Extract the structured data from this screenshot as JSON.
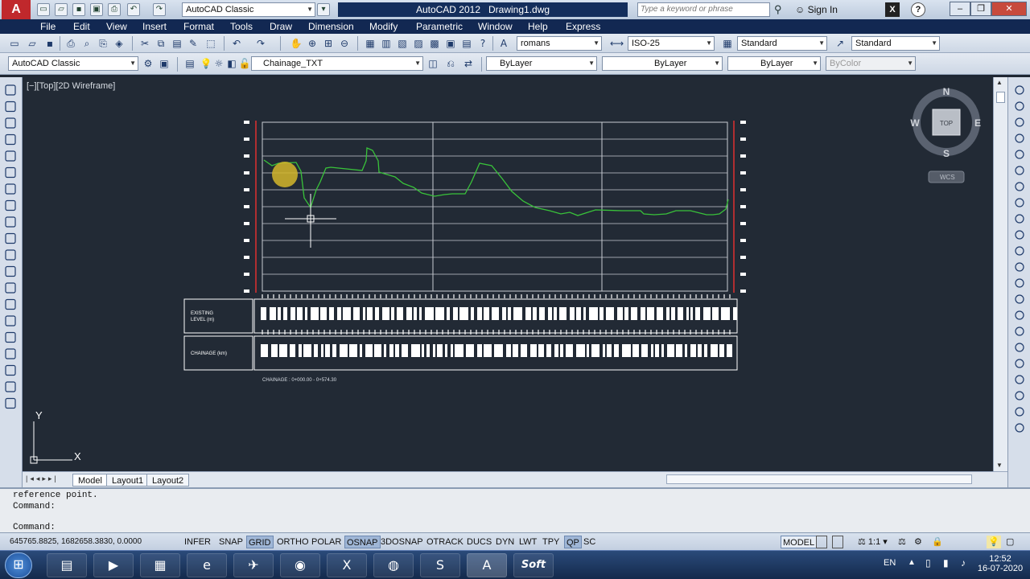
{
  "titlebar": {
    "workspace": "AutoCAD Classic",
    "app_title": "AutoCAD 2012",
    "doc_title": "Drawing1.dwg",
    "search_placeholder": "Type a keyword or phrase",
    "sign_in": "Sign In"
  },
  "menu": [
    "File",
    "Edit",
    "View",
    "Insert",
    "Format",
    "Tools",
    "Draw",
    "Dimension",
    "Modify",
    "Parametric",
    "Window",
    "Help",
    "Express"
  ],
  "styles_toolbar": {
    "text_style": "romans",
    "dim_style": "ISO-25",
    "table_style": "Standard",
    "multileader_style": "Standard"
  },
  "layers_toolbar": {
    "workspace": "AutoCAD Classic",
    "layer": "Chainage_TXT",
    "color": "ByLayer",
    "linetype": "ByLayer",
    "lineweight": "ByLayer",
    "plotstyle": "ByColor"
  },
  "viewport_label": "[−][Top][2D Wireframe]",
  "viewcube": {
    "n": "N",
    "s": "S",
    "e": "E",
    "w": "W",
    "face": "TOP",
    "wcs": "WCS"
  },
  "drawing": {
    "row1_label": "EXISTING LEVEL (m)",
    "row2_label": "CHAINAGE (km)",
    "chainage_note": "CHAINAGE : 0+000.00 - 0+574.30"
  },
  "ucs": {
    "x": "X",
    "y": "Y"
  },
  "tabs": [
    "Model",
    "Layout1",
    "Layout2"
  ],
  "command": {
    "line1": "reference point.",
    "line2": "Command:",
    "prompt": "Command:"
  },
  "status": {
    "coords": "645765.8825, 1682658.3830, 0.0000",
    "toggles": [
      {
        "label": "INFER",
        "on": false
      },
      {
        "label": "SNAP",
        "on": false
      },
      {
        "label": "GRID",
        "on": true
      },
      {
        "label": "ORTHO",
        "on": false
      },
      {
        "label": "POLAR",
        "on": false
      },
      {
        "label": "OSNAP",
        "on": true
      },
      {
        "label": "3DOSNAP",
        "on": false
      },
      {
        "label": "OTRACK",
        "on": false
      },
      {
        "label": "DUCS",
        "on": false
      },
      {
        "label": "DYN",
        "on": false
      },
      {
        "label": "LWT",
        "on": false
      },
      {
        "label": "TPY",
        "on": false
      },
      {
        "label": "QP",
        "on": true
      },
      {
        "label": "SC",
        "on": false
      }
    ],
    "space": "MODEL",
    "scale": "1:1"
  },
  "taskbar": {
    "lang": "EN",
    "time": "12:52",
    "date": "16-07-2020",
    "soft_label": "Soft"
  },
  "colors": {
    "canvas": "#222a35",
    "profile": "#39c23a",
    "grid": "#c8ccd2",
    "menu": "#122852",
    "red_axis": "#e03030"
  }
}
